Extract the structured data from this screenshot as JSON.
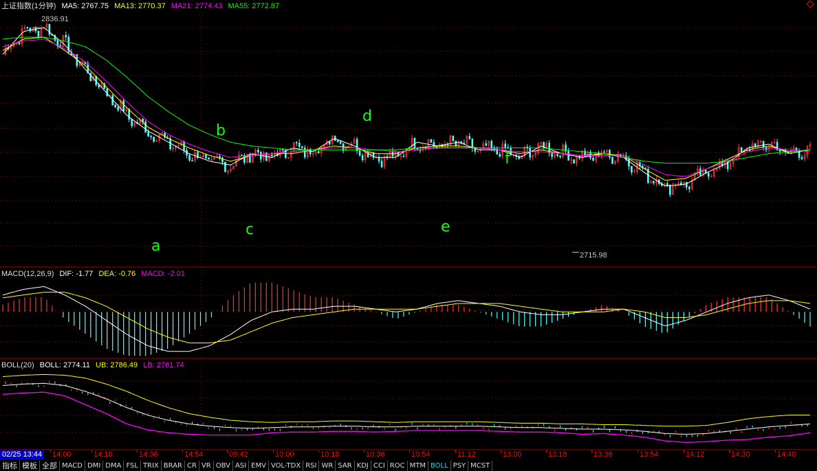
{
  "main_panel": {
    "title": "上证指数(1分钟)",
    "ma5": "MA5: 2767.75",
    "ma13": "MA13: 2770.37",
    "ma21": "MA21: 2774.43",
    "ma55": "MA55: 2772.87",
    "high_label": "2836.91",
    "low_label": "2715.98",
    "wave_labels": [
      "a",
      "b",
      "c",
      "d",
      "e",
      "f"
    ]
  },
  "macd_panel": {
    "title": "MACD(12,26,9)",
    "dif": "DIF: -1.77",
    "dea": "DEA: -0.76",
    "macd": "MACD: -2.01"
  },
  "boll_panel": {
    "title": "BOLL(20)",
    "boll": "BOLL: 2774.11",
    "ub": "UB: 2786.49",
    "lb": "LB: 2761.74"
  },
  "time_axis": {
    "cursor_date": "02/25 13:44",
    "ticks": [
      "14:00",
      "14:18",
      "14:36",
      "14:54",
      "09:42",
      "10:00",
      "10:18",
      "10:36",
      "10:54",
      "11:12",
      "13:00",
      "13:18",
      "13:36",
      "13:54",
      "14:12",
      "14:30",
      "14:48"
    ]
  },
  "bottom_tabs": [
    "指标",
    "模板",
    "全部",
    "MACD",
    "DMI",
    "DMA",
    "FSL",
    "TRIX",
    "BRAR",
    "CR",
    "VR",
    "OBV",
    "ASI",
    "EMV",
    "VOL-TDX",
    "RSI",
    "WR",
    "SAR",
    "KDJ",
    "CCI",
    "ROC",
    "MTM",
    "BOLL",
    "PSY",
    "MCST"
  ],
  "active_tab": "BOLL",
  "colors": {
    "background": "#000000",
    "up": "#ff3232",
    "down": "#54ffff",
    "ma5": "#ffffff",
    "ma13": "#ffff00",
    "ma21": "#ff00ff",
    "ma55": "#00ff00",
    "grid": "#a00000",
    "label_green": "#10ff10"
  },
  "chart_data": [
    {
      "type": "candlestick",
      "title": "上证指数(1分钟)",
      "series": [
        {
          "name": "MA5",
          "values": [
            2820,
            2832,
            2834,
            2825,
            2812,
            2800,
            2788,
            2780,
            2774,
            2768,
            2764,
            2762,
            2768,
            2766,
            2771,
            2769,
            2776,
            2772,
            2766,
            2766,
            2774,
            2772,
            2774,
            2770,
            2770,
            2766,
            2772,
            2768,
            2766,
            2768,
            2766,
            2758,
            2751,
            2752,
            2758,
            2763,
            2771,
            2773,
            2768,
            2770
          ]
        },
        {
          "name": "MA13",
          "values": [
            2822,
            2828,
            2829,
            2822,
            2814,
            2803,
            2792,
            2782,
            2776,
            2771,
            2767,
            2764,
            2767,
            2768,
            2768,
            2770,
            2772,
            2771,
            2768,
            2768,
            2771,
            2772,
            2772,
            2771,
            2770,
            2768,
            2770,
            2768,
            2767,
            2768,
            2767,
            2760,
            2754,
            2755,
            2760,
            2765,
            2770,
            2772,
            2769,
            2770
          ]
        },
        {
          "name": "MA21",
          "values": [
            2824,
            2827,
            2828,
            2823,
            2816,
            2806,
            2795,
            2785,
            2778,
            2773,
            2769,
            2766,
            2767,
            2768,
            2769,
            2770,
            2771,
            2771,
            2770,
            2769,
            2770,
            2771,
            2771,
            2771,
            2770,
            2769,
            2769,
            2768,
            2767,
            2767,
            2767,
            2762,
            2757,
            2756,
            2760,
            2764,
            2769,
            2771,
            2770,
            2769
          ]
        },
        {
          "name": "MA55",
          "values": [
            2828,
            2829,
            2829,
            2827,
            2824,
            2817,
            2808,
            2798,
            2790,
            2783,
            2778,
            2774,
            2772,
            2771,
            2770,
            2770,
            2770,
            2770,
            2770,
            2770,
            2771,
            2771,
            2771,
            2771,
            2771,
            2771,
            2771,
            2770,
            2769,
            2768,
            2766,
            2764,
            2763,
            2763,
            2763,
            2764,
            2766,
            2768,
            2769,
            2770
          ]
        }
      ],
      "high": 2836.91,
      "low": 2715.98
    },
    {
      "type": "bar",
      "title": "MACD(12,26,9)",
      "series": [
        {
          "name": "DIF",
          "values": [
            6,
            8,
            9,
            6,
            2,
            -3,
            -8,
            -12,
            -14,
            -14,
            -12,
            -8,
            -3,
            0,
            1,
            1,
            2,
            2,
            1,
            0,
            1,
            3,
            4,
            3,
            2,
            0,
            -1,
            -1,
            0,
            1,
            1,
            -2,
            -5,
            -3,
            0,
            3,
            5,
            6,
            4,
            1
          ]
        },
        {
          "name": "DEA",
          "values": [
            5,
            6,
            7,
            7,
            5,
            2,
            -2,
            -6,
            -9,
            -11,
            -11,
            -10,
            -7,
            -4,
            -2,
            -1,
            0,
            1,
            1,
            1,
            1,
            2,
            3,
            3,
            3,
            2,
            1,
            0,
            0,
            0,
            1,
            0,
            -2,
            -2,
            -1,
            1,
            3,
            4,
            4,
            3
          ]
        },
        {
          "name": "MACD",
          "values": [
            2,
            4,
            4,
            -2,
            -6,
            -10,
            -12,
            -12,
            -10,
            -6,
            -2,
            4,
            8,
            8,
            6,
            4,
            4,
            2,
            0,
            -2,
            0,
            2,
            2,
            0,
            -2,
            -4,
            -4,
            -2,
            0,
            2,
            0,
            -4,
            -6,
            -2,
            2,
            4,
            4,
            4,
            0,
            -4
          ]
        }
      ]
    },
    {
      "type": "line",
      "title": "BOLL(20)",
      "series": [
        {
          "name": "BOLL",
          "values": [
            2826,
            2828,
            2829,
            2826,
            2818,
            2808,
            2796,
            2786,
            2779,
            2774,
            2771,
            2769,
            2768,
            2769,
            2770,
            2770,
            2771,
            2771,
            2770,
            2770,
            2771,
            2771,
            2771,
            2771,
            2770,
            2769,
            2769,
            2768,
            2767,
            2767,
            2766,
            2764,
            2761,
            2760,
            2761,
            2764,
            2767,
            2770,
            2772,
            2774
          ]
        },
        {
          "name": "UB",
          "values": [
            2838,
            2840,
            2841,
            2840,
            2836,
            2828,
            2818,
            2806,
            2796,
            2788,
            2783,
            2779,
            2777,
            2776,
            2777,
            2777,
            2778,
            2778,
            2777,
            2776,
            2777,
            2777,
            2777,
            2777,
            2776,
            2775,
            2775,
            2774,
            2774,
            2773,
            2773,
            2772,
            2771,
            2771,
            2772,
            2776,
            2781,
            2784,
            2786,
            2786
          ]
        },
        {
          "name": "LB",
          "values": [
            2814,
            2816,
            2817,
            2812,
            2800,
            2788,
            2774,
            2766,
            2762,
            2760,
            2759,
            2759,
            2759,
            2762,
            2763,
            2763,
            2764,
            2764,
            2763,
            2764,
            2765,
            2765,
            2765,
            2765,
            2764,
            2763,
            2763,
            2762,
            2760,
            2761,
            2759,
            2756,
            2751,
            2749,
            2750,
            2752,
            2753,
            2756,
            2758,
            2762
          ]
        }
      ]
    }
  ]
}
